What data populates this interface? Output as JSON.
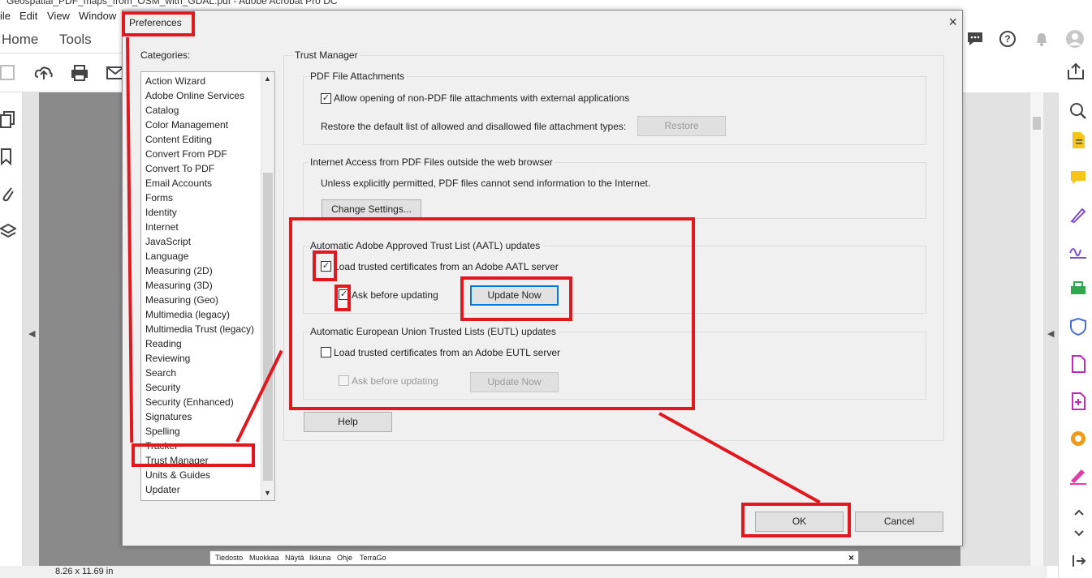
{
  "window": {
    "title": "Geospatial_PDF_maps_from_OSM_with_GDAL.pdf - Adobe Acrobat Pro DC"
  },
  "menubar": {
    "items": [
      "ile",
      "Edit",
      "View",
      "Window"
    ]
  },
  "tabs": {
    "home": "Home",
    "tools": "Tools"
  },
  "status": {
    "page_size": "8.26 x 11.69 in"
  },
  "bottom_window": {
    "menu": [
      "Tiedosto",
      "Muokkaa",
      "Näytä",
      "Ikkuna",
      "Ohje",
      "TerraGo"
    ],
    "close": "×"
  },
  "dialog": {
    "title": "Preferences",
    "close": "×",
    "categories_label": "Categories:",
    "categories": [
      "Action Wizard",
      "Adobe Online Services",
      "Catalog",
      "Color Management",
      "Content Editing",
      "Convert From PDF",
      "Convert To PDF",
      "Email Accounts",
      "Forms",
      "Identity",
      "Internet",
      "JavaScript",
      "Language",
      "Measuring (2D)",
      "Measuring (3D)",
      "Measuring (Geo)",
      "Multimedia (legacy)",
      "Multimedia Trust (legacy)",
      "Reading",
      "Reviewing",
      "Search",
      "Security",
      "Security (Enhanced)",
      "Signatures",
      "Spelling",
      "Tracker",
      "Trust Manager",
      "Units & Guides",
      "Updater"
    ],
    "selected_category": "Trust Manager",
    "panel_title": "Trust Manager",
    "pdf_attachments": {
      "title": "PDF File Attachments",
      "allow_label": "Allow opening of non-PDF file attachments with external applications",
      "allow_checked": true,
      "restore_text": "Restore the default list of allowed and disallowed file attachment types:",
      "restore_button": "Restore"
    },
    "internet_access": {
      "title": "Internet Access from PDF Files outside the web browser",
      "text": "Unless explicitly permitted, PDF files cannot send information to the Internet.",
      "button": "Change Settings..."
    },
    "aatl": {
      "title": "Automatic Adobe Approved Trust List (AATL) updates",
      "load_label": "Load trusted certificates from an Adobe AATL server",
      "load_checked": true,
      "ask_label": "Ask before updating",
      "ask_checked": true,
      "update_button": "Update Now"
    },
    "eutl": {
      "title": "Automatic European Union Trusted Lists (EUTL) updates",
      "load_label": "Load trusted certificates from an Adobe EUTL server",
      "load_checked": false,
      "ask_label": "Ask before updating",
      "ask_checked": false,
      "update_button": "Update Now"
    },
    "help_button": "Help",
    "ok_button": "OK",
    "cancel_button": "Cancel"
  },
  "colors": {
    "highlight": "#e2181f",
    "focus": "#0078d7",
    "dialog_bg": "#f0f0f0"
  },
  "icons": {
    "check": "✓",
    "up": "▲",
    "down": "▼",
    "left": "◀"
  }
}
